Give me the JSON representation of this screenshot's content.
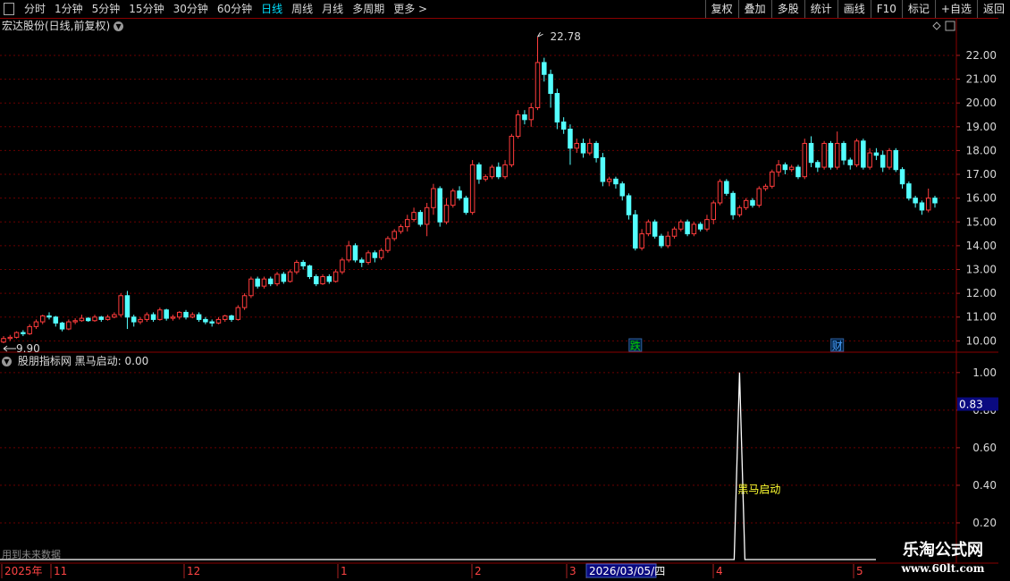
{
  "toolbar": {
    "left_items": [
      "分时",
      "1分钟",
      "5分钟",
      "15分钟",
      "30分钟",
      "60分钟",
      "日线",
      "周线",
      "月线",
      "多周期",
      "更多 >"
    ],
    "active_item": "日线",
    "right_buttons": [
      "复权",
      "叠加",
      "多股",
      "统计",
      "画线",
      "F10",
      "标记",
      "+自选",
      "返回"
    ]
  },
  "main_panel": {
    "title": "宏达股份(日线,前复权)",
    "y_ticks": [
      "22.00",
      "21.00",
      "20.00",
      "19.00",
      "18.00",
      "17.00",
      "16.00",
      "15.00",
      "14.00",
      "13.00",
      "12.00",
      "11.00",
      "10.00"
    ],
    "high_label": "22.78",
    "low_label": "9.90",
    "markers": [
      {
        "text": "跌",
        "color": "#00d000"
      },
      {
        "text": "财",
        "color": "#4aa0ff"
      }
    ]
  },
  "indicator_panel": {
    "title": "股朋指标网  黑马启动: 0.00",
    "y_ticks": [
      "1.00",
      "0.80",
      "0.60",
      "0.40",
      "0.20"
    ],
    "current_value_tag": "0.83",
    "signal_label": "黑马启动"
  },
  "date_axis": {
    "labels": [
      "2025年",
      "11",
      "12",
      "1",
      "2",
      "3",
      "2026/03/05/四",
      "4",
      "5"
    ]
  },
  "footer": {
    "future_note": "用到未来数据"
  },
  "watermark": {
    "title": "乐淘公式网",
    "url": "www.60lt.com"
  },
  "chart_data": [
    {
      "type": "candlestick",
      "ylim": [
        9.6,
        22.9
      ],
      "candles": [
        [
          9.95,
          10.1,
          9.9,
          10.2
        ],
        [
          10.1,
          10.15,
          10.0,
          10.25
        ],
        [
          10.15,
          10.35,
          10.1,
          10.4
        ],
        [
          10.35,
          10.3,
          10.2,
          10.45
        ],
        [
          10.3,
          10.6,
          10.25,
          10.7
        ],
        [
          10.6,
          10.8,
          10.5,
          10.9
        ],
        [
          10.8,
          11.05,
          10.7,
          11.1
        ],
        [
          11.05,
          11.0,
          10.9,
          11.2
        ],
        [
          11.0,
          10.75,
          10.6,
          11.05
        ],
        [
          10.75,
          10.5,
          10.4,
          10.8
        ],
        [
          10.5,
          10.8,
          10.45,
          10.9
        ],
        [
          10.8,
          10.85,
          10.7,
          10.95
        ],
        [
          10.85,
          10.95,
          10.8,
          11.1
        ],
        [
          10.95,
          10.85,
          10.8,
          11.0
        ],
        [
          10.85,
          11.0,
          10.8,
          11.1
        ],
        [
          11.0,
          10.9,
          10.8,
          11.05
        ],
        [
          10.9,
          11.0,
          10.85,
          11.1
        ],
        [
          11.0,
          11.1,
          10.95,
          11.2
        ],
        [
          11.1,
          11.9,
          11.0,
          12.0
        ],
        [
          11.9,
          11.0,
          10.5,
          12.1
        ],
        [
          11.0,
          10.8,
          10.6,
          11.1
        ],
        [
          10.8,
          10.9,
          10.7,
          11.0
        ],
        [
          10.9,
          11.1,
          10.8,
          11.2
        ],
        [
          11.1,
          10.9,
          10.8,
          11.2
        ],
        [
          10.9,
          11.3,
          10.85,
          11.4
        ],
        [
          11.3,
          10.95,
          10.85,
          11.35
        ],
        [
          10.95,
          11.0,
          10.85,
          11.1
        ],
        [
          11.0,
          11.2,
          10.9,
          11.25
        ],
        [
          11.2,
          11.0,
          10.9,
          11.3
        ],
        [
          11.0,
          11.1,
          10.95,
          11.2
        ],
        [
          11.1,
          10.9,
          10.8,
          11.2
        ],
        [
          10.9,
          10.8,
          10.7,
          11.0
        ],
        [
          10.8,
          10.75,
          10.6,
          10.9
        ],
        [
          10.75,
          10.9,
          10.7,
          11.0
        ],
        [
          10.9,
          11.05,
          10.8,
          11.1
        ],
        [
          11.05,
          10.9,
          10.8,
          11.1
        ],
        [
          10.9,
          11.4,
          10.85,
          11.5
        ],
        [
          11.4,
          11.9,
          11.3,
          12.0
        ],
        [
          11.9,
          12.6,
          11.8,
          12.7
        ],
        [
          12.6,
          12.3,
          12.2,
          12.7
        ],
        [
          12.3,
          12.6,
          12.2,
          12.7
        ],
        [
          12.6,
          12.4,
          12.3,
          12.7
        ],
        [
          12.4,
          12.8,
          12.3,
          12.9
        ],
        [
          12.8,
          12.5,
          12.4,
          12.9
        ],
        [
          12.5,
          12.9,
          12.45,
          13.0
        ],
        [
          12.9,
          13.3,
          12.8,
          13.4
        ],
        [
          13.3,
          13.15,
          13.0,
          13.4
        ],
        [
          13.15,
          12.7,
          12.6,
          13.2
        ],
        [
          12.7,
          12.4,
          12.3,
          12.8
        ],
        [
          12.4,
          12.7,
          12.35,
          12.8
        ],
        [
          12.7,
          12.5,
          12.4,
          12.8
        ],
        [
          12.5,
          12.9,
          12.45,
          13.0
        ],
        [
          12.9,
          13.4,
          12.8,
          13.5
        ],
        [
          13.4,
          14.0,
          13.3,
          14.2
        ],
        [
          14.0,
          13.4,
          13.3,
          14.1
        ],
        [
          13.4,
          13.3,
          13.1,
          13.5
        ],
        [
          13.3,
          13.7,
          13.2,
          13.8
        ],
        [
          13.7,
          13.5,
          13.3,
          13.8
        ],
        [
          13.5,
          13.8,
          13.4,
          13.9
        ],
        [
          13.8,
          14.3,
          13.7,
          14.4
        ],
        [
          14.3,
          14.6,
          14.2,
          14.7
        ],
        [
          14.6,
          14.8,
          14.5,
          14.9
        ],
        [
          14.8,
          15.1,
          14.6,
          15.3
        ],
        [
          15.1,
          15.4,
          15.0,
          15.6
        ],
        [
          15.4,
          14.9,
          14.8,
          15.5
        ],
        [
          14.9,
          15.6,
          14.4,
          15.8
        ],
        [
          15.6,
          16.4,
          15.3,
          16.6
        ],
        [
          16.4,
          15.0,
          14.8,
          16.5
        ],
        [
          15.0,
          15.7,
          14.9,
          16.0
        ],
        [
          15.7,
          16.3,
          15.6,
          16.4
        ],
        [
          16.3,
          16.0,
          15.9,
          16.5
        ],
        [
          16.0,
          15.4,
          15.3,
          16.1
        ],
        [
          15.4,
          17.4,
          15.3,
          17.6
        ],
        [
          17.4,
          16.8,
          16.6,
          17.5
        ],
        [
          16.8,
          16.9,
          16.7,
          17.0
        ],
        [
          16.9,
          17.3,
          16.8,
          17.4
        ],
        [
          17.3,
          16.9,
          16.8,
          17.5
        ],
        [
          16.9,
          17.4,
          16.8,
          17.6
        ],
        [
          17.4,
          18.6,
          17.3,
          18.7
        ],
        [
          18.6,
          19.5,
          18.5,
          19.7
        ],
        [
          19.5,
          19.3,
          19.1,
          19.7
        ],
        [
          19.3,
          19.8,
          19.0,
          20.0
        ],
        [
          19.8,
          21.7,
          19.7,
          22.78
        ],
        [
          21.7,
          21.2,
          20.9,
          21.9
        ],
        [
          21.2,
          20.4,
          19.8,
          21.4
        ],
        [
          20.4,
          19.2,
          18.9,
          20.6
        ],
        [
          19.2,
          18.9,
          18.7,
          19.4
        ],
        [
          18.9,
          18.1,
          17.4,
          19.1
        ],
        [
          18.1,
          18.3,
          17.9,
          18.5
        ],
        [
          18.3,
          17.9,
          17.7,
          18.5
        ],
        [
          17.9,
          18.3,
          17.8,
          18.5
        ],
        [
          18.3,
          17.7,
          17.5,
          18.4
        ],
        [
          17.7,
          16.7,
          16.5,
          17.9
        ],
        [
          16.7,
          16.8,
          16.5,
          16.9
        ],
        [
          16.8,
          16.6,
          16.4,
          16.9
        ],
        [
          16.6,
          16.1,
          15.9,
          16.7
        ],
        [
          16.1,
          15.3,
          15.1,
          16.2
        ],
        [
          15.3,
          13.9,
          13.8,
          15.5
        ],
        [
          13.9,
          14.5,
          13.8,
          14.7
        ],
        [
          14.5,
          15.0,
          14.4,
          15.1
        ],
        [
          15.0,
          14.4,
          14.3,
          15.1
        ],
        [
          14.4,
          14.0,
          13.9,
          14.5
        ],
        [
          14.0,
          14.4,
          13.9,
          14.6
        ],
        [
          14.4,
          14.7,
          14.3,
          14.8
        ],
        [
          14.7,
          15.0,
          14.6,
          15.1
        ],
        [
          15.0,
          14.5,
          14.4,
          15.1
        ],
        [
          14.5,
          14.9,
          14.4,
          15.0
        ],
        [
          14.9,
          14.7,
          14.6,
          15.0
        ],
        [
          14.7,
          15.1,
          14.6,
          15.3
        ],
        [
          15.1,
          15.8,
          14.9,
          15.9
        ],
        [
          15.8,
          16.7,
          15.7,
          16.8
        ],
        [
          16.7,
          16.2,
          16.1,
          16.8
        ],
        [
          16.2,
          15.3,
          15.1,
          16.3
        ],
        [
          15.3,
          15.6,
          15.2,
          15.7
        ],
        [
          15.6,
          15.9,
          15.5,
          16.0
        ],
        [
          15.9,
          15.7,
          15.6,
          16.0
        ],
        [
          15.7,
          16.4,
          15.6,
          16.5
        ],
        [
          16.4,
          16.5,
          16.3,
          16.6
        ],
        [
          16.5,
          17.1,
          16.4,
          17.2
        ],
        [
          17.1,
          17.4,
          16.9,
          17.6
        ],
        [
          17.4,
          17.2,
          17.0,
          17.5
        ],
        [
          17.2,
          17.3,
          17.1,
          17.4
        ],
        [
          17.3,
          16.9,
          16.8,
          17.4
        ],
        [
          16.9,
          18.3,
          16.8,
          18.5
        ],
        [
          18.3,
          17.5,
          17.3,
          18.6
        ],
        [
          17.5,
          17.3,
          17.1,
          17.6
        ],
        [
          17.3,
          18.3,
          17.2,
          18.4
        ],
        [
          18.3,
          17.3,
          17.2,
          18.4
        ],
        [
          17.3,
          18.3,
          17.2,
          18.8
        ],
        [
          18.3,
          17.6,
          17.4,
          18.4
        ],
        [
          17.6,
          17.4,
          17.2,
          17.7
        ],
        [
          17.4,
          18.4,
          17.3,
          18.5
        ],
        [
          18.4,
          17.3,
          17.2,
          18.5
        ],
        [
          17.3,
          17.9,
          17.2,
          18.1
        ],
        [
          17.9,
          17.8,
          17.6,
          18.1
        ],
        [
          17.8,
          17.3,
          17.1,
          18.0
        ],
        [
          17.3,
          18.0,
          17.2,
          18.1
        ],
        [
          18.0,
          17.2,
          17.1,
          18.1
        ],
        [
          17.2,
          16.6,
          16.4,
          17.3
        ],
        [
          16.6,
          16.0,
          15.9,
          16.7
        ],
        [
          16.0,
          15.8,
          15.6,
          16.1
        ],
        [
          15.8,
          15.5,
          15.3,
          15.9
        ],
        [
          15.5,
          16.0,
          15.4,
          16.4
        ],
        [
          16.0,
          15.8,
          15.6,
          16.1
        ]
      ]
    },
    {
      "type": "line",
      "series": [
        {
          "name": "黑马启动",
          "peak_value": 1.0
        }
      ],
      "ylim": [
        0.0,
        1.08
      ]
    }
  ]
}
